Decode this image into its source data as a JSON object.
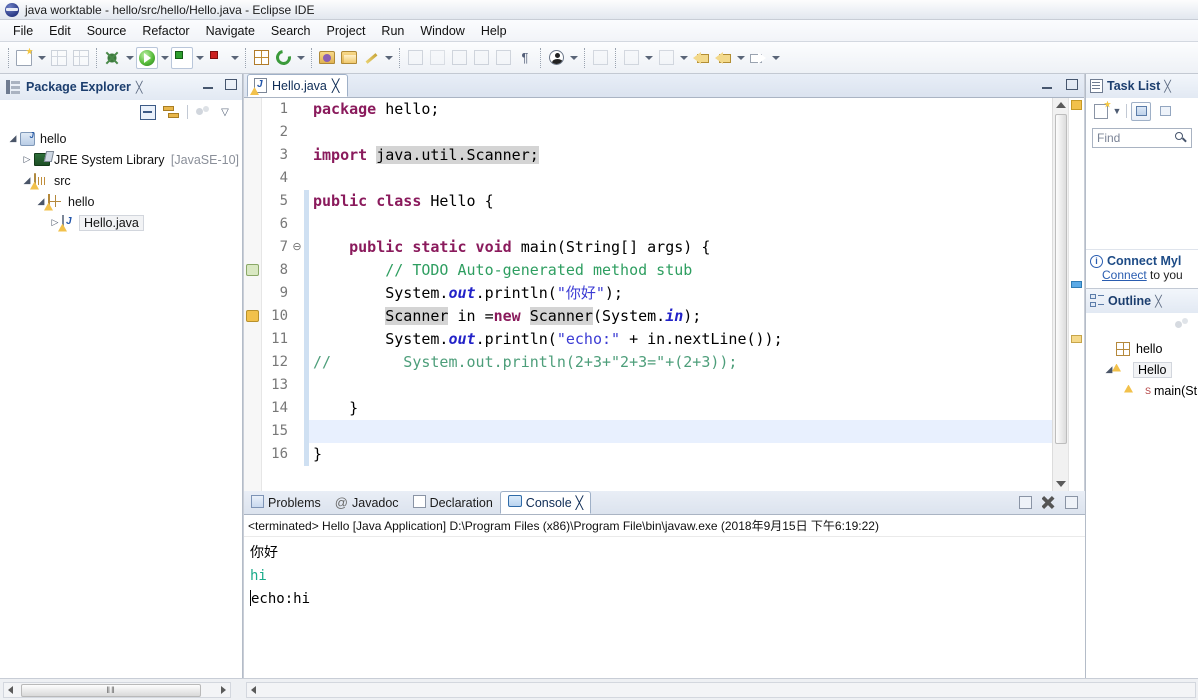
{
  "window": {
    "title": "java worktable - hello/src/hello/Hello.java - Eclipse IDE",
    "app_icon": "eclipse-icon"
  },
  "menubar": {
    "items": [
      "File",
      "Edit",
      "Source",
      "Refactor",
      "Navigate",
      "Search",
      "Project",
      "Run",
      "Window",
      "Help"
    ]
  },
  "toolbar": {
    "icons": [
      "new-wizard-icon",
      "save-icon",
      "save-all-icon",
      "debug-icon",
      "run-icon",
      "coverage-icon",
      "run-external-tools-icon",
      "new-java-package-icon",
      "refresh-icon",
      "open-type-icon",
      "open-task-icon",
      "pencil-icon",
      "toggle-mark-occurrences-icon",
      "skip-breakpoints-icon",
      "next-annotation-icon",
      "previous-annotation-icon",
      "show-whitespace-icon",
      "user-icon",
      "link-icon",
      "pin-editor-icon",
      "back-icon",
      "forward-icon"
    ]
  },
  "package_explorer": {
    "title": "Package Explorer",
    "close_label": "╳",
    "toolbar_icons": [
      "collapse-all-icon",
      "link-with-editor-icon",
      "view-menu-icon",
      "chevron-down-icon"
    ],
    "tree": [
      {
        "label": "hello",
        "icon": "java-project-icon",
        "indent": 0,
        "expanded": true,
        "selected": false,
        "suffix": ""
      },
      {
        "label": "JRE System Library",
        "icon": "jre-library-icon",
        "indent": 1,
        "expanded": false,
        "selected": false,
        "suffix": "[JavaSE-10]"
      },
      {
        "label": "src",
        "icon": "source-folder-icon",
        "indent": 1,
        "expanded": true,
        "selected": false,
        "suffix": ""
      },
      {
        "label": "hello",
        "icon": "package-icon",
        "indent": 2,
        "expanded": true,
        "selected": false,
        "suffix": ""
      },
      {
        "label": "Hello.java",
        "icon": "java-file-icon",
        "indent": 3,
        "expanded": false,
        "selected": true,
        "suffix": ""
      }
    ]
  },
  "editor": {
    "tab_label": "Hello.java",
    "tab_icon": "java-file-warning-icon",
    "close_label": "╳",
    "lines": [
      {
        "num": "1",
        "fold": "",
        "marker": "",
        "current": false,
        "tokens": [
          {
            "t": "package ",
            "c": "kw"
          },
          {
            "t": "hello;",
            "c": ""
          }
        ]
      },
      {
        "num": "2",
        "fold": "",
        "marker": "",
        "current": false,
        "tokens": []
      },
      {
        "num": "3",
        "fold": "",
        "marker": "",
        "current": false,
        "tokens": [
          {
            "t": "import ",
            "c": "kw"
          },
          {
            "t": "java.util.Scanner;",
            "c": "hl"
          }
        ]
      },
      {
        "num": "4",
        "fold": "",
        "marker": "",
        "current": false,
        "tokens": []
      },
      {
        "num": "5",
        "fold": "",
        "marker": "",
        "current": false,
        "tokens": [
          {
            "t": "public class ",
            "c": "kw"
          },
          {
            "t": "Hello {",
            "c": ""
          }
        ]
      },
      {
        "num": "6",
        "fold": "",
        "marker": "",
        "current": false,
        "tokens": []
      },
      {
        "num": "7",
        "fold": "⊖",
        "marker": "",
        "current": false,
        "tokens": [
          {
            "t": "    ",
            "c": ""
          },
          {
            "t": "public static void ",
            "c": "kw"
          },
          {
            "t": "main(String[] args) {",
            "c": ""
          }
        ]
      },
      {
        "num": "8",
        "fold": "",
        "marker": "todo-marker",
        "current": false,
        "tokens": [
          {
            "t": "        ",
            "c": ""
          },
          {
            "t": "// TODO Auto-generated method stub",
            "c": "cmt"
          }
        ]
      },
      {
        "num": "9",
        "fold": "",
        "marker": "",
        "current": false,
        "tokens": [
          {
            "t": "        System.",
            "c": ""
          },
          {
            "t": "out",
            "c": "fieldi"
          },
          {
            "t": ".println(",
            "c": ""
          },
          {
            "t": "\"你好\"",
            "c": "str"
          },
          {
            "t": ");",
            "c": ""
          }
        ]
      },
      {
        "num": "10",
        "fold": "",
        "marker": "warning-marker",
        "current": false,
        "tokens": [
          {
            "t": "        ",
            "c": ""
          },
          {
            "t": "Scanner",
            "c": "hl"
          },
          {
            "t": " in =",
            "c": ""
          },
          {
            "t": "new ",
            "c": "kw"
          },
          {
            "t": "Scanner",
            "c": "hl"
          },
          {
            "t": "(System.",
            "c": ""
          },
          {
            "t": "in",
            "c": "fieldi"
          },
          {
            "t": ");",
            "c": ""
          }
        ]
      },
      {
        "num": "11",
        "fold": "",
        "marker": "",
        "current": false,
        "tokens": [
          {
            "t": "        System.",
            "c": ""
          },
          {
            "t": "out",
            "c": "fieldi"
          },
          {
            "t": ".println(",
            "c": ""
          },
          {
            "t": "\"echo:\"",
            "c": "str"
          },
          {
            "t": " + in.nextLine());",
            "c": ""
          }
        ]
      },
      {
        "num": "12",
        "fold": "",
        "marker": "",
        "current": false,
        "tokens": [
          {
            "t": "//        System.out.println(2+3+\"2+3=\"+(2+3));",
            "c": "cmt2"
          }
        ]
      },
      {
        "num": "13",
        "fold": "",
        "marker": "",
        "current": false,
        "tokens": []
      },
      {
        "num": "14",
        "fold": "",
        "marker": "",
        "current": false,
        "tokens": [
          {
            "t": "    }",
            "c": ""
          }
        ]
      },
      {
        "num": "15",
        "fold": "",
        "marker": "",
        "current": true,
        "tokens": []
      },
      {
        "num": "16",
        "fold": "",
        "marker": "",
        "current": false,
        "tokens": [
          {
            "t": "}",
            "c": ""
          }
        ]
      }
    ]
  },
  "console": {
    "tabs": [
      {
        "label": "Problems",
        "icon": "problems-icon",
        "active": false
      },
      {
        "label": "Javadoc",
        "icon": "javadoc-icon",
        "active": false
      },
      {
        "label": "Declaration",
        "icon": "declaration-icon",
        "active": false
      },
      {
        "label": "Console",
        "icon": "console-icon",
        "active": true
      }
    ],
    "close_label": "╳",
    "toolbar_icons": [
      "clear-console-icon",
      "terminate-icon",
      "remove-all-terminated-icon",
      "display-selected-console-icon",
      "scroll-lock-icon",
      "pin-console-icon",
      "open-console-icon",
      "new-console-view-icon"
    ],
    "status_line": "<terminated> Hello [Java Application] D:\\Program Files (x86)\\Program File\\bin\\javaw.exe (2018年9月15日 下午6:19:22)",
    "output": [
      {
        "text": "你好",
        "kind": "stdout"
      },
      {
        "text": "hi",
        "kind": "stdin"
      },
      {
        "text": "echo:hi",
        "kind": "stdout"
      }
    ]
  },
  "task_list": {
    "title": "Task List",
    "close_label": "╳",
    "toolbar_icons": [
      "new-task-icon",
      "chevron-down-icon",
      "categorized-presentation-icon",
      "scheduled-presentation-icon"
    ],
    "find_placeholder": "Find",
    "find_value": "",
    "search_icon": "search-icon",
    "mylyn": {
      "info_icon": "info-icon",
      "title": "Connect Myl",
      "link": "Connect",
      "rest": " to you"
    }
  },
  "outline": {
    "title": "Outline",
    "close_label": "╳",
    "toolbar_icons": [
      "view-menu-icon"
    ],
    "tree": [
      {
        "label": "hello",
        "icon": "package-icon",
        "indent": 1,
        "expanded": null,
        "selected": false,
        "sup": ""
      },
      {
        "label": "Hello",
        "icon": "class-icon",
        "indent": 1,
        "expanded": true,
        "selected": true,
        "sup": ""
      },
      {
        "label": "main(St",
        "icon": "method-icon",
        "indent": 2,
        "expanded": null,
        "selected": false,
        "sup": "S"
      }
    ]
  },
  "scrollbars": {
    "explorer_thumb_glyph": "‖‖",
    "left_arrow": "◂",
    "right_arrow": "▸"
  },
  "colors": {
    "keyword": "#8a1a5c",
    "string": "#3b3bd4",
    "comment": "#2e9e60",
    "field": "#2222c8",
    "console_stdin": "#1aab8a",
    "current_line": "#e8f0fe",
    "highlight": "#d4d4d4",
    "panel_title": "#1c3e6e"
  }
}
